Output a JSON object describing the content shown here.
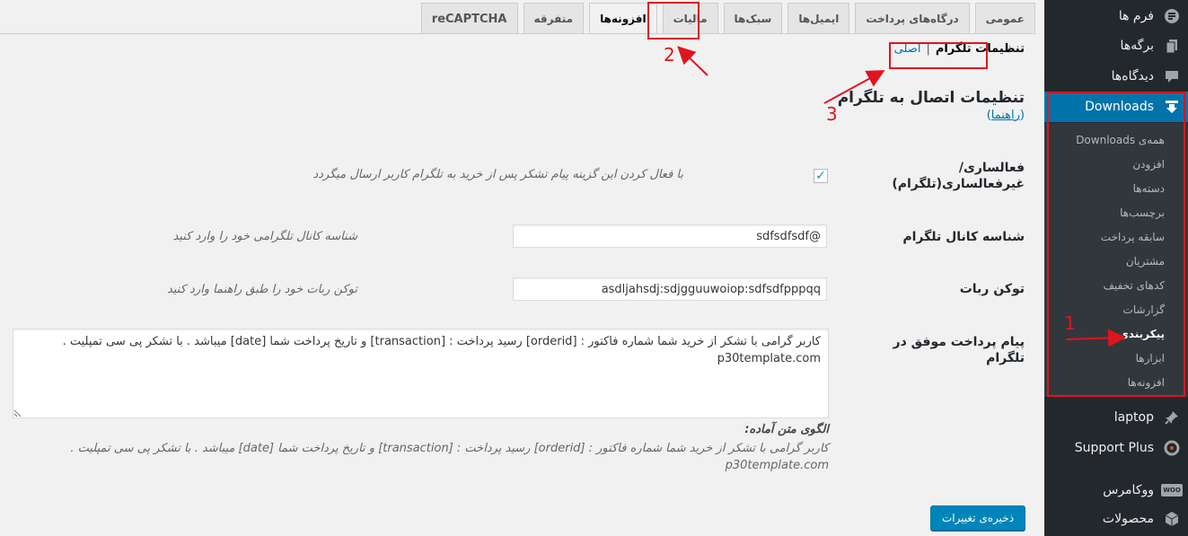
{
  "sidebar": {
    "items": [
      {
        "label": "فرم ها",
        "icon": "forms-icon"
      },
      {
        "label": "برگه‌ها",
        "icon": "pages-icon"
      },
      {
        "label": "دیدگاه‌ها",
        "icon": "comments-icon"
      },
      {
        "label": "Downloads",
        "icon": "download-icon"
      },
      {
        "label": "laptop",
        "icon": "pin-icon"
      },
      {
        "label": "Support Plus",
        "icon": "support-icon"
      },
      {
        "label": "ووکامرس",
        "icon": "woocommerce-icon"
      },
      {
        "label": "محصولات",
        "icon": "products-icon"
      }
    ],
    "woo_badge": "WOO",
    "submenu": [
      "همه‌ی Downloads",
      "افزودن",
      "دسته‌ها",
      "برچسب‌ها",
      "سابقه پرداخت",
      "مشتریان",
      "کدهای تخفیف",
      "گزارشات",
      "پیکربندی",
      "ابزارها",
      "افزونه‌ها"
    ]
  },
  "tabs": [
    "عمومی",
    "درگاه‌های پرداخت",
    "ایمیل‌ها",
    "سبک‌ها",
    "مالیات",
    "افزونه‌ها",
    "متفرقه",
    "reCAPTCHA"
  ],
  "subnav": {
    "main": "اصلی",
    "current": "تنظیمات تلگرام"
  },
  "section": {
    "title": "تنظیمات اتصال به تلگرام",
    "guide_link": "راهنما",
    "guide_open": "(",
    "guide_close": ")"
  },
  "fields": {
    "activate": {
      "label": "فعالساری/غیرفعالساری(تلگرام)",
      "checked": true,
      "check_mark": "✓",
      "desc": "با فعال کردن این گزینه پیام تشکر پس از خرید به تلگرام کاربر ارسال میگردد"
    },
    "channel": {
      "label": "شناسه کانال تلگرام",
      "value": "sdfsdfsdf@",
      "desc": "شناسه کانال تلگرامی خود را وارد کنید"
    },
    "bot_token": {
      "label": "توکن ربات",
      "value": "asdljahsdj:sdjgguuwoiop:sdfsdfpppqq",
      "desc": "توکن ربات خود را طبق راهنما وارد کنید"
    },
    "message": {
      "label": "پیام پرداخت موفق در تلگرام",
      "value": "کاربر گرامی با تشکر از خرید شما شماره فاکتور : [orderid] رسید پرداخت : [transaction] و تاریخ پرداخت شما [date] میباشد . با تشکر پی سی تمپلیت . p30template.com",
      "template_title": "الگوی متن آماده:",
      "template_text": "کاربر گرامی با تشکر از خرید شما شماره فاکتور : [orderid] رسید پرداخت : [transaction] و تاریخ پرداخت شما [date] میباشد . با تشکر پی سی تمپلیت . p30template.com"
    }
  },
  "save_button": "ذخیره‌ی تغییرات",
  "annotations": {
    "one": "1",
    "two": "2",
    "three": "3"
  },
  "colors": {
    "accent": "#0073aa",
    "annotation": "#e0141e",
    "sidebar": "#23282d",
    "button": "#0085ba"
  }
}
